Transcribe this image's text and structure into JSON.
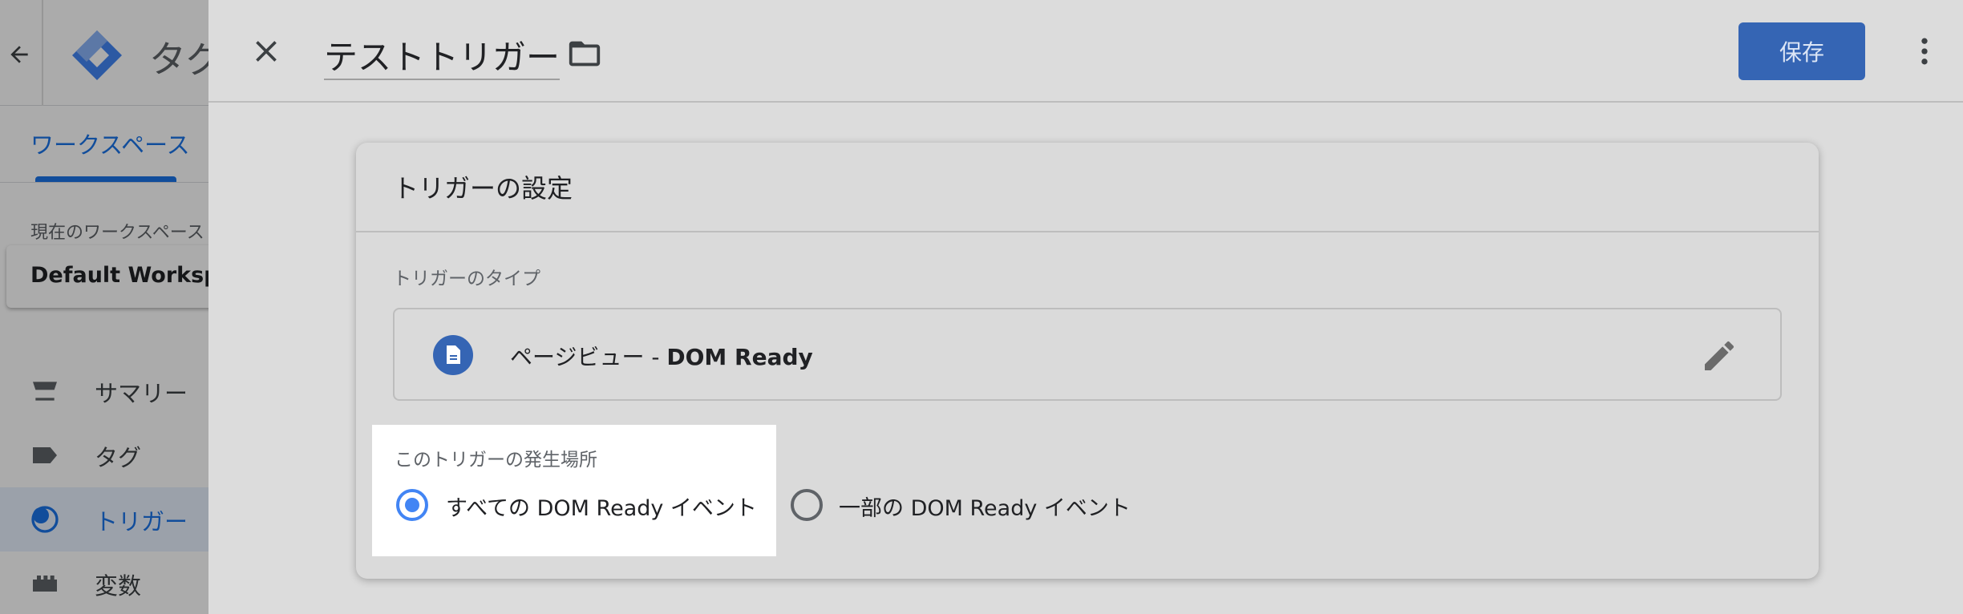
{
  "app": {
    "title": "タグ",
    "subnav_tab": "ワークスペース",
    "workspace_label": "現在のワークスペース",
    "workspace_name": "Default Workspa",
    "sidebar": [
      {
        "label": "サマリー",
        "icon": "summary-icon"
      },
      {
        "label": "タグ",
        "icon": "tag-icon"
      },
      {
        "label": "トリガー",
        "icon": "trigger-icon",
        "active": true
      },
      {
        "label": "変数",
        "icon": "variables-icon"
      }
    ]
  },
  "editor": {
    "trigger_name": "テストトリガー",
    "save_label": "保存",
    "card_title": "トリガーの設定",
    "trigger_type_label": "トリガーのタイプ",
    "trigger_type_prefix": "ページビュー - ",
    "trigger_type_name": "DOM Ready",
    "fires_on_label": "このトリガーの発生場所",
    "option_all": "すべての DOM Ready イベント",
    "option_some": "一部の DOM Ready イベント",
    "selected_option": "option_all"
  },
  "colors": {
    "accent": "#1a73e8",
    "save_button": "#3565b4",
    "radio_selected": "#4285f4"
  }
}
